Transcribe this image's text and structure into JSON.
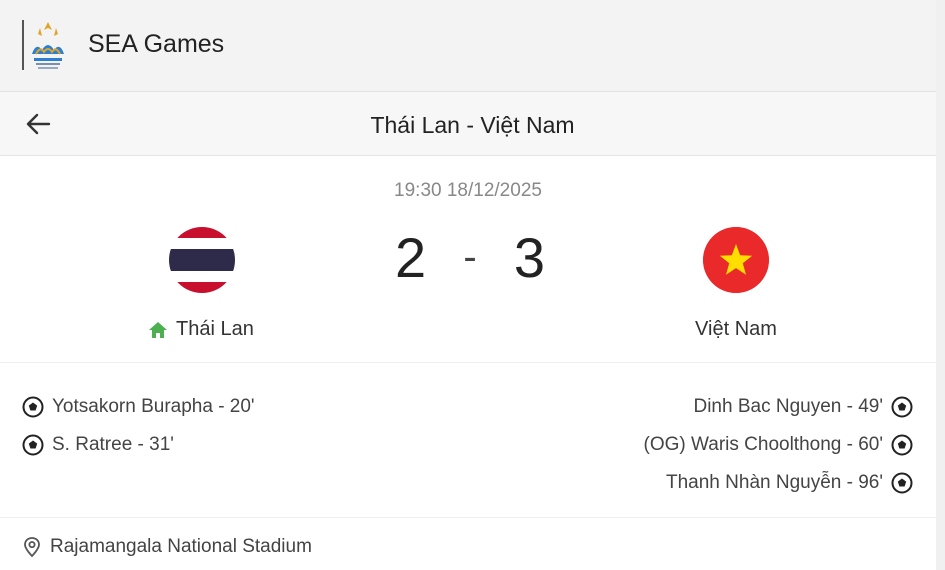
{
  "app": {
    "title": "SEA Games"
  },
  "match": {
    "title": "Thái Lan - Việt Nam",
    "datetime": "19:30 18/12/2025",
    "home": {
      "name": "Thái Lan",
      "score": "2"
    },
    "away": {
      "name": "Việt Nam",
      "score": "3"
    },
    "separator": "-",
    "home_goals": [
      {
        "text": "Yotsakorn Burapha - 20'"
      },
      {
        "text": "S. Ratree - 31'"
      }
    ],
    "away_goals": [
      {
        "text": "Dinh Bac Nguyen - 49'"
      },
      {
        "text": "(OG) Waris Choolthong - 60'"
      },
      {
        "text": "Thanh Nhàn Nguyễn - 96'"
      }
    ],
    "venue": "Rajamangala National Stadium"
  },
  "icons": {
    "back": "arrow-left-icon",
    "home_indicator": "home-icon",
    "goal": "soccer-ball-icon",
    "venue": "location-pin-icon"
  },
  "colors": {
    "home_icon": "#4caf50",
    "vn_red": "#ea2a2a",
    "vn_star": "#ffde00",
    "th_red": "#c8102e",
    "th_blue": "#2d2a4a"
  }
}
